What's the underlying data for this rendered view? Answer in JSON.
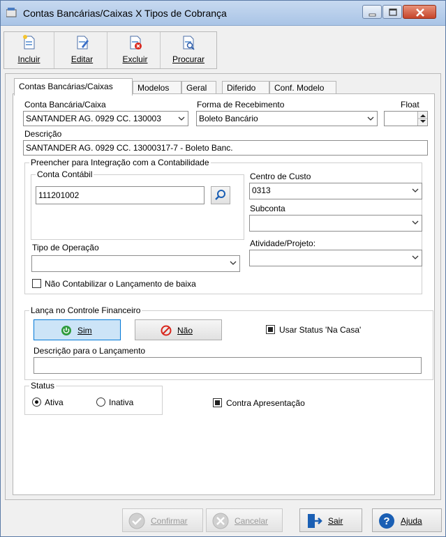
{
  "window": {
    "title": "Contas Bancárias/Caixas X Tipos de Cobrança"
  },
  "toolbar": {
    "buttons": [
      {
        "label": "Incluir",
        "icon": "new-document-icon"
      },
      {
        "label": "Editar",
        "icon": "edit-document-icon"
      },
      {
        "label": "Excluir",
        "icon": "delete-document-icon"
      },
      {
        "label": "Procurar",
        "icon": "search-document-icon"
      }
    ]
  },
  "tabs": [
    "Contas Bancárias/Caixas",
    "Modelos",
    "Geral",
    "Diferido",
    "Conf. Modelo"
  ],
  "form": {
    "conta_label": "Conta Bancária/Caixa",
    "conta_value": "SANTANDER AG. 0929 CC. 130003",
    "forma_label": "Forma de Recebimento",
    "forma_value": "Boleto Bancário",
    "float_label": "Float",
    "float_value": "",
    "descricao_label": "Descrição",
    "descricao_value": "SANTANDER AG. 0929 CC. 13000317-7 - Boleto Banc.",
    "integracao_title": "Preencher para Integração com a Contabilidade",
    "conta_contabil_title": "Conta Contábil",
    "conta_contabil_value": "111201002",
    "centro_custo_label": "Centro de Custo",
    "centro_custo_value": "0313",
    "subconta_label": "Subconta",
    "subconta_value": "",
    "tipo_operacao_label": "Tipo de Operação",
    "tipo_operacao_value": "",
    "atividade_label": "Atividade/Projeto:",
    "atividade_value": "",
    "nao_contabilizar_label": "Não Contabilizar o Lançamento de baixa",
    "nao_contabilizar_checked": false,
    "financeiro_title": "Lança no Controle Financeiro",
    "sim_label": "Sim",
    "nao_label": "Não",
    "usar_status_label": "Usar Status 'Na Casa'",
    "usar_status_checked": true,
    "desc_lancamento_label": "Descrição para o Lançamento",
    "desc_lancamento_value": "",
    "status_title": "Status",
    "status_ativa": "Ativa",
    "status_inativa": "Inativa",
    "status_selected": "Ativa",
    "contra_apresentacao_label": "Contra Apresentação",
    "contra_apresentacao_checked": true
  },
  "footer": {
    "confirmar": "Confirmar",
    "cancelar": "Cancelar",
    "sair": "Sair",
    "ajuda": "Ajuda"
  },
  "colors": {
    "accent_blue": "#1a5fb4",
    "sim_bg": "#cce4f7",
    "sim_border": "#0078d7",
    "nao_red": "#d9261c",
    "sim_green": "#2e9b3c"
  }
}
